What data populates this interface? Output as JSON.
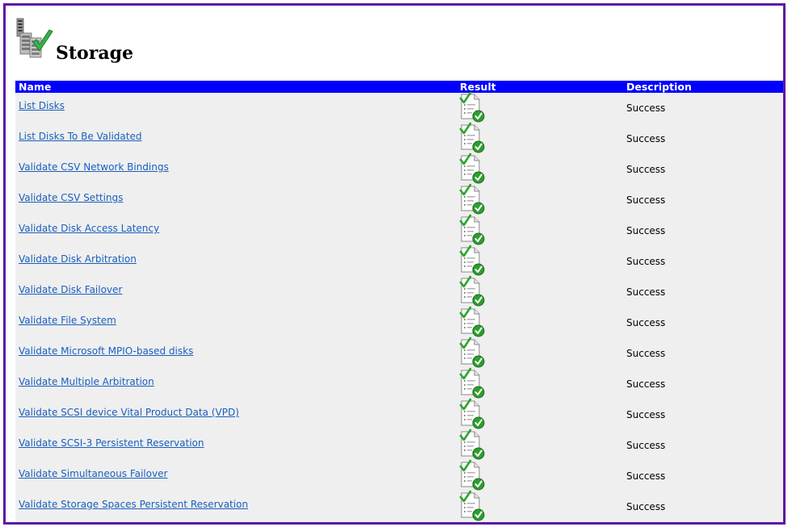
{
  "page": {
    "title": "Storage",
    "icon": "storage-server-check-icon"
  },
  "table": {
    "headers": {
      "name": "Name",
      "result": "Result",
      "description": "Description"
    },
    "rows": [
      {
        "name": "List Disks",
        "result_icon": "success-report-icon",
        "description": "Success"
      },
      {
        "name": "List Disks To Be Validated",
        "result_icon": "success-report-icon",
        "description": "Success"
      },
      {
        "name": "Validate CSV Network Bindings",
        "result_icon": "success-report-icon",
        "description": "Success"
      },
      {
        "name": "Validate CSV Settings",
        "result_icon": "success-report-icon",
        "description": "Success"
      },
      {
        "name": "Validate Disk Access Latency",
        "result_icon": "success-report-icon",
        "description": "Success"
      },
      {
        "name": "Validate Disk Arbitration",
        "result_icon": "success-report-icon",
        "description": "Success"
      },
      {
        "name": "Validate Disk Failover",
        "result_icon": "success-report-icon",
        "description": "Success"
      },
      {
        "name": "Validate File System",
        "result_icon": "success-report-icon",
        "description": "Success"
      },
      {
        "name": "Validate Microsoft MPIO-based disks",
        "result_icon": "success-report-icon",
        "description": "Success"
      },
      {
        "name": "Validate Multiple Arbitration",
        "result_icon": "success-report-icon",
        "description": "Success"
      },
      {
        "name": "Validate SCSI device Vital Product Data (VPD)",
        "result_icon": "success-report-icon",
        "description": "Success"
      },
      {
        "name": "Validate SCSI-3 Persistent Reservation",
        "result_icon": "success-report-icon",
        "description": "Success"
      },
      {
        "name": "Validate Simultaneous Failover",
        "result_icon": "success-report-icon",
        "description": "Success"
      },
      {
        "name": "Validate Storage Spaces Persistent Reservation",
        "result_icon": "success-report-icon",
        "description": "Success"
      }
    ]
  },
  "colors": {
    "frame_border": "#5a1aa3",
    "header_bg": "#0000ff",
    "header_text": "#ffffff",
    "row_bg": "#efefef",
    "link": "#1a5fbf",
    "success_green": "#2e9e2e"
  }
}
